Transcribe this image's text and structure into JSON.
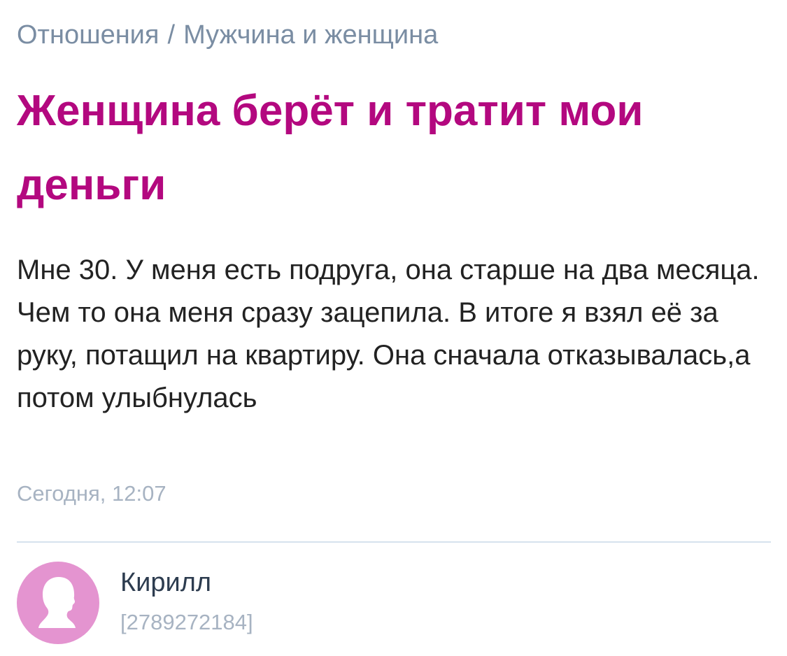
{
  "breadcrumb": {
    "category": "Отношения",
    "separator": "/",
    "subcategory": "Мужчина и женщина"
  },
  "post": {
    "title": "Женщина берёт и тратит мои деньги",
    "body": "Мне 30. У меня есть подруга, она старше на два месяца. Чем то она меня сразу зацепила. В итоге я взял её за руку, потащил на квартиру. Она сначала отказывалась,а потом улыбнулась",
    "timestamp": "Сегодня, 12:07"
  },
  "author": {
    "name": "Кирилл",
    "id": "[2789272184]",
    "avatar_icon": "user-silhouette-icon"
  },
  "colors": {
    "title": "#b3087f",
    "breadcrumb": "#7a8da3",
    "body_text": "#222222",
    "meta": "#a7b3c2",
    "author_name": "#2d3c4f",
    "divider": "#d6e2ee",
    "avatar_bg": "#e494d0"
  }
}
